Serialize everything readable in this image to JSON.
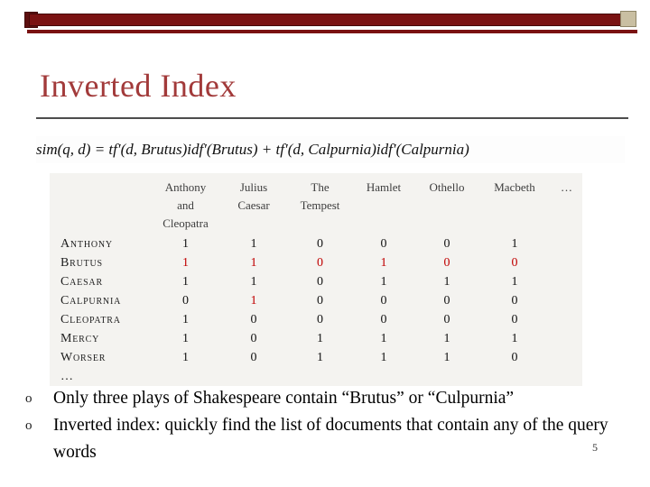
{
  "slide": {
    "title": "Inverted Index",
    "page_number": "5"
  },
  "formula": {
    "text": "sim(q, d) = tf′(d, Brutus)idf′(Brutus) + tf′(d, Calpurnia)idf′(Calpurnia)"
  },
  "matrix": {
    "columns": [
      "Anthony\nand\nCleopatra",
      "Julius\nCaesar",
      "The\nTempest",
      "Hamlet",
      "Othello",
      "Macbeth",
      "…"
    ],
    "rows": [
      {
        "term": "Anthony",
        "values": [
          "1",
          "1",
          "0",
          "0",
          "0",
          "1"
        ],
        "red": [
          0,
          0,
          0,
          0,
          0,
          0
        ]
      },
      {
        "term": "Brutus",
        "values": [
          "1",
          "1",
          "0",
          "1",
          "0",
          "0"
        ],
        "red": [
          1,
          1,
          1,
          1,
          1,
          1
        ]
      },
      {
        "term": "Caesar",
        "values": [
          "1",
          "1",
          "0",
          "1",
          "1",
          "1"
        ],
        "red": [
          0,
          0,
          0,
          0,
          0,
          0
        ]
      },
      {
        "term": "Calpurnia",
        "values": [
          "0",
          "1",
          "0",
          "0",
          "0",
          "0"
        ],
        "red": [
          0,
          1,
          0,
          0,
          0,
          0
        ]
      },
      {
        "term": "Cleopatra",
        "values": [
          "1",
          "0",
          "0",
          "0",
          "0",
          "0"
        ],
        "red": [
          0,
          0,
          0,
          0,
          0,
          0
        ]
      },
      {
        "term": "Mercy",
        "values": [
          "1",
          "0",
          "1",
          "1",
          "1",
          "1"
        ],
        "red": [
          0,
          0,
          0,
          0,
          0,
          0
        ]
      },
      {
        "term": "Worser",
        "values": [
          "1",
          "0",
          "1",
          "1",
          "1",
          "0"
        ],
        "red": [
          0,
          0,
          0,
          0,
          0,
          0
        ]
      },
      {
        "term": "…",
        "values": [
          "",
          "",
          "",
          "",
          "",
          ""
        ],
        "red": [
          0,
          0,
          0,
          0,
          0,
          0
        ]
      }
    ]
  },
  "bullets": [
    {
      "marker": "o",
      "text": "Only three plays of Shakespeare contain “Brutus” or “Culpurnia”"
    },
    {
      "marker": "o",
      "text": "Inverted index: quickly find the list of documents that contain any of the query words"
    }
  ],
  "colors": {
    "accent_maroon": "#7a1212",
    "title_red": "#a23a3a",
    "highlight_red": "#c00000"
  }
}
